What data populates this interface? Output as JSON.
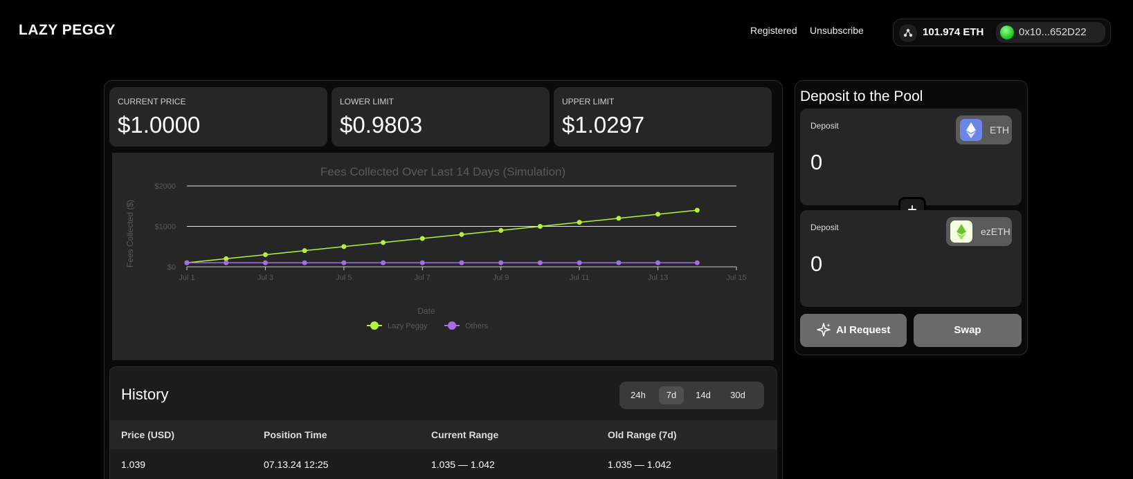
{
  "header": {
    "brand": "LAZY PEGGY",
    "nav": [
      "Registered",
      "Unsubscribe"
    ],
    "wallet": {
      "network_icon": "network-icon",
      "eth_balance": "101.974 ETH",
      "address": "0x10...652D22",
      "status_color": "#22cc22"
    }
  },
  "stats": [
    {
      "label": "CURRENT PRICE",
      "value": "$1.0000"
    },
    {
      "label": "LOWER LIMIT",
      "value": "$0.9803"
    },
    {
      "label": "UPPER LIMIT",
      "value": "$1.0297"
    }
  ],
  "chart_data": {
    "type": "line",
    "title": "Fees Collected Over Last 14 Days (Simulation)",
    "xlabel": "Date",
    "ylabel": "Fees Collected ($)",
    "x": [
      "Jul 1",
      "Jul 2",
      "Jul 3",
      "Jul 4",
      "Jul 5",
      "Jul 6",
      "Jul 7",
      "Jul 8",
      "Jul 9",
      "Jul 10",
      "Jul 11",
      "Jul 12",
      "Jul 13",
      "Jul 14"
    ],
    "x_ticks": [
      "Jul 1",
      "Jul 3",
      "Jul 5",
      "Jul 7",
      "Jul 9",
      "Jul 11",
      "Jul 13",
      "Jul 15"
    ],
    "y_ticks": [
      "$0",
      "$1000",
      "$2000"
    ],
    "ylim": [
      0,
      2000
    ],
    "grid": true,
    "legend_position": "bottom",
    "series": [
      {
        "name": "Lazy Peggy",
        "color": "#b5f23c",
        "values": [
          100,
          200,
          300,
          400,
          500,
          600,
          700,
          800,
          900,
          1000,
          1100,
          1200,
          1300,
          1400
        ]
      },
      {
        "name": "Others",
        "color": "#a66ee6",
        "values": [
          100,
          100,
          100,
          100,
          100,
          100,
          100,
          100,
          100,
          100,
          100,
          100,
          100,
          100
        ]
      }
    ]
  },
  "history": {
    "title": "History",
    "ranges": [
      "24h",
      "7d",
      "14d",
      "30d"
    ],
    "active_range": "7d",
    "columns": [
      "Price (USD)",
      "Position Time",
      "Current Range",
      "Old Range (7d)"
    ],
    "rows": [
      [
        "1.039",
        "07.13.24 12:25",
        "1.035 — 1.042",
        "1.035 — 1.042"
      ]
    ]
  },
  "deposit": {
    "title": "Deposit to the Pool",
    "cards": [
      {
        "label": "Deposit",
        "value": "0",
        "token": "ETH",
        "token_icon": "eth-icon"
      },
      {
        "label": "Deposit",
        "value": "0",
        "token": "ezETH",
        "token_icon": "ezeth-icon"
      }
    ],
    "plus_label": "+",
    "ai_button": "AI Request",
    "swap_button": "Swap"
  }
}
